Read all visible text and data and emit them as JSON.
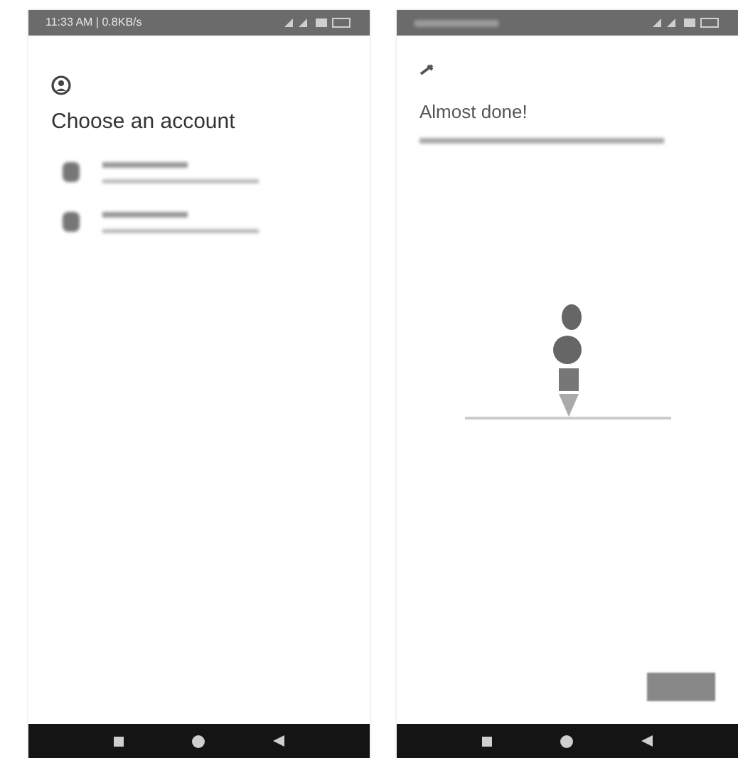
{
  "screens": [
    {
      "kind": "accounts",
      "status_bar": {
        "time": "11:33 AM | 0.8KB/s"
      },
      "title": "Choose an account",
      "accounts": [
        {
          "kind": "blurred"
        },
        {
          "kind": "blurred"
        }
      ]
    },
    {
      "kind": "setup",
      "title": "Almost done!"
    }
  ]
}
